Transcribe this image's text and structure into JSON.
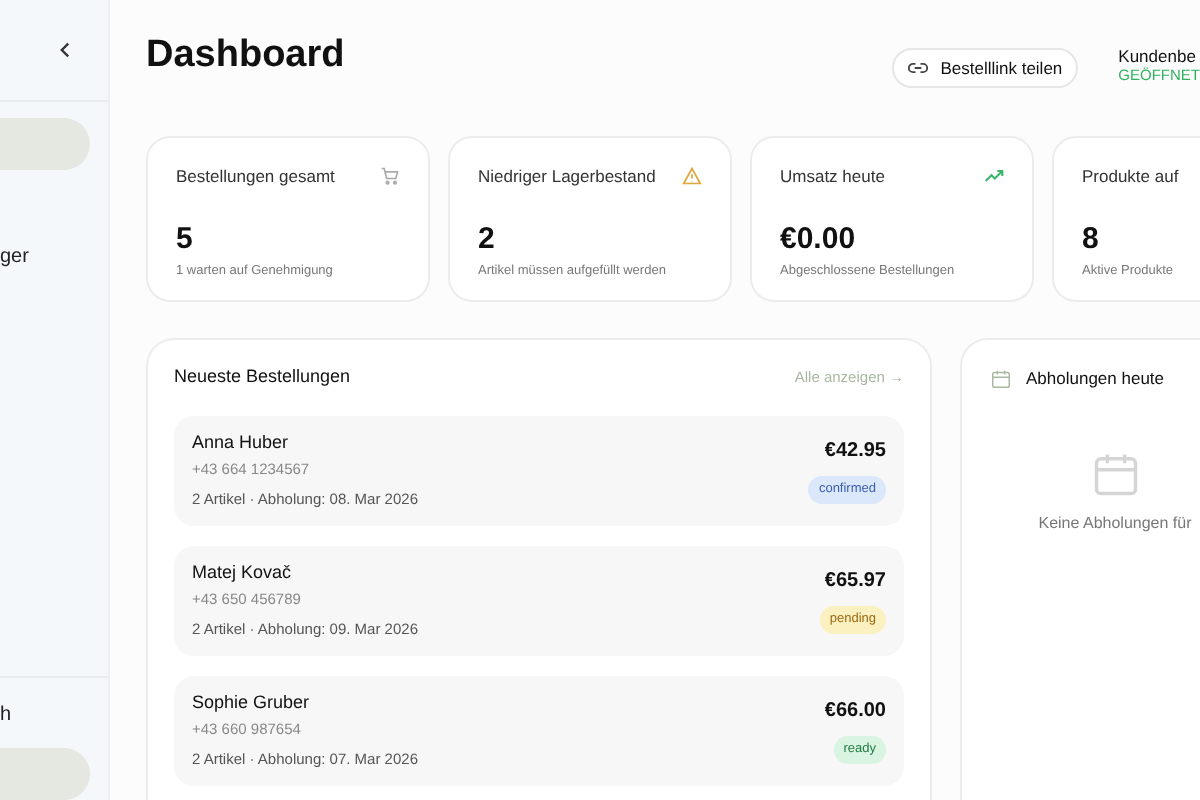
{
  "sidebar": {
    "items": [
      {
        "selected": true
      },
      {
        "label": "ger",
        "selected": false
      }
    ],
    "bottom_items": [
      {
        "label": "h",
        "selected": false
      },
      {
        "selected": true
      }
    ]
  },
  "header": {
    "title": "Dashboard",
    "share_button": "Bestelllink teilen",
    "store_status": {
      "label": "Kundenbe",
      "status": "GEÖFFNET"
    }
  },
  "stats": [
    {
      "title": "Bestellungen gesamt",
      "value": "5",
      "note": "1 warten auf Genehmigung",
      "kind": "cart"
    },
    {
      "title": "Niedriger Lagerbestand",
      "value": "2",
      "note": "Artikel müssen aufgefüllt werden",
      "kind": "warning"
    },
    {
      "title": "Umsatz heute",
      "value": "€0.00",
      "note": "Abgeschlossene Bestellungen",
      "kind": "trend"
    },
    {
      "title": "Produkte auf",
      "value": "8",
      "note": "Aktive Produkte",
      "kind": "none"
    }
  ],
  "orders": {
    "title": "Neueste Bestellungen",
    "link": "Alle anzeigen →",
    "rows": [
      {
        "name": "Anna Huber",
        "phone": "+43 664 1234567",
        "details": "2 Artikel · Abholung: 08. Mar 2026",
        "total": "€42.95",
        "status": "confirmed"
      },
      {
        "name": "Matej Kovač",
        "phone": "+43 650 456789",
        "details": "2 Artikel · Abholung: 09. Mar 2026",
        "total": "€65.97",
        "status": "pending"
      },
      {
        "name": "Sophie Gruber",
        "phone": "+43 660 987654",
        "details": "2 Artikel · Abholung: 07. Mar 2026",
        "total": "€66.00",
        "status": "ready"
      }
    ]
  },
  "pickups": {
    "title": "Abholungen heute",
    "empty": "Keine Abholungen für"
  }
}
